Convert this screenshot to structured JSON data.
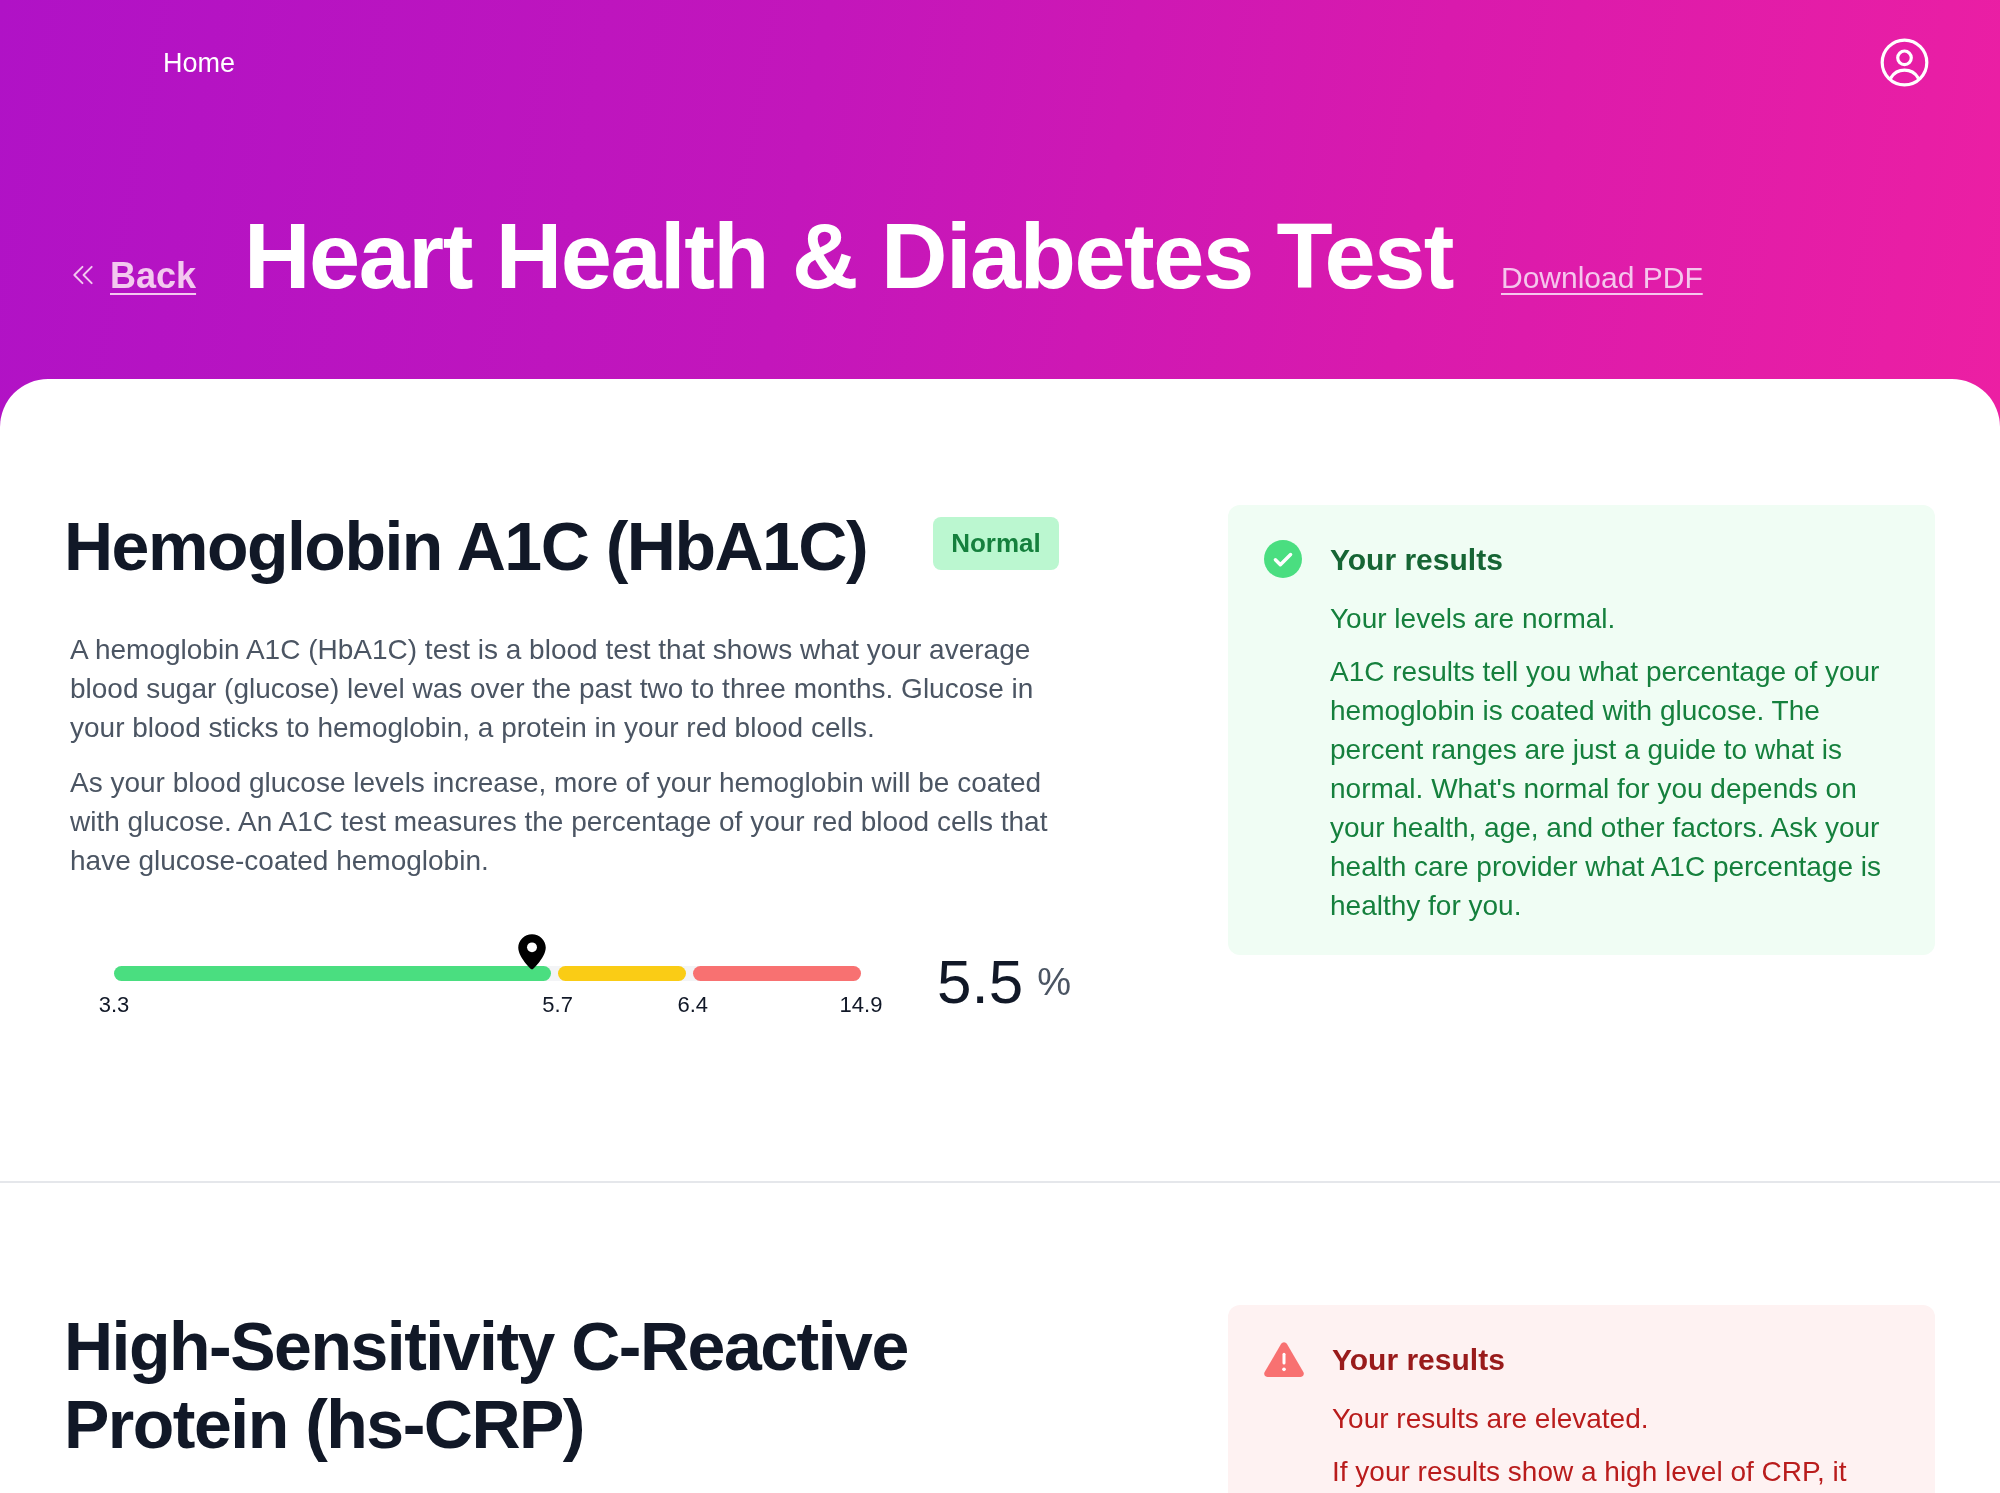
{
  "nav": {
    "home": "Home"
  },
  "header": {
    "back": "Back",
    "title": "Heart Health & Diabetes Test",
    "download": "Download PDF"
  },
  "tests": [
    {
      "kind": "normal",
      "title": "Hemoglobin A1C (HbA1C)",
      "badge": "Normal",
      "description": [
        "A hemoglobin A1C (HbA1C) test is a blood test that shows what your average blood sugar (glucose) level was over the past two to three months. Glucose in your blood sticks to hemoglobin, a protein in your red blood cells.",
        "As your blood glucose levels increase, more of your hemoglobin will be coated with glucose. An A1C test measures the percentage of your red blood cells that have glucose-coated hemoglobin."
      ],
      "gauge": {
        "segments": [
          {
            "color": "#4ade80"
          },
          {
            "color": "#facc15"
          },
          {
            "color": "#f87171"
          }
        ],
        "ticks": [
          "3.3",
          "5.7",
          "6.4",
          "14.9"
        ],
        "marker": {
          "level": 0.56
        },
        "value": "5.5",
        "unit": "%"
      },
      "results": {
        "heading": "Your results",
        "summary": "Your levels are normal.",
        "details": [
          "A1C results tell you what percentage of your hemoglobin is coated with glucose. The percent ranges are just a guide to what is normal. What's normal for you depends on your health, age, and other factors. Ask your health care provider what A1C percentage is healthy for you."
        ]
      }
    },
    {
      "kind": "elevated",
      "title": "High-Sensitivity C-Reactive Protein (hs-CRP)",
      "results": {
        "heading": "Your results",
        "summary": "Your results are elevated.",
        "details": [
          "If your results show a high level of CRP, it"
        ]
      }
    }
  ]
}
